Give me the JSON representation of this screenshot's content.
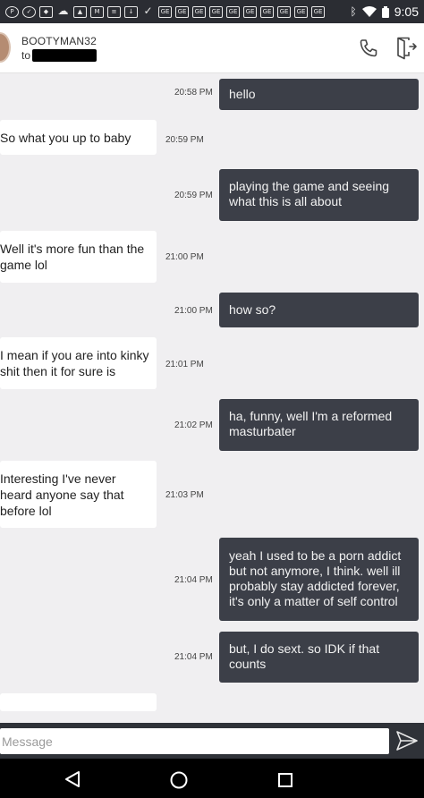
{
  "status_bar": {
    "time": "9:05",
    "icons": [
      "pinterest-icon",
      "check-icon",
      "shield-icon",
      "cloud-icon",
      "image-icon",
      "gmail-icon",
      "news-icon",
      "download-icon",
      "check-mark-icon",
      "ge-icon",
      "ge-icon",
      "ge-icon",
      "ge-icon",
      "ge-icon",
      "ge-icon",
      "ge-icon",
      "ge-icon",
      "ge-icon",
      "ge-icon",
      "bluetooth-icon",
      "wifi-icon",
      "battery-icon"
    ],
    "ge_label": "GE"
  },
  "header": {
    "contact_name": "BOOTYMAN32",
    "to_prefix": "to"
  },
  "messages": [
    {
      "direction": "out",
      "text": "hello",
      "time": "20:58 PM"
    },
    {
      "direction": "in",
      "text": "So what you up to baby",
      "time": "20:59 PM"
    },
    {
      "direction": "out",
      "text": "playing the game and seeing what this is all about",
      "time": "20:59 PM"
    },
    {
      "direction": "in",
      "text": "Well it's more fun than the game lol",
      "time": "21:00 PM"
    },
    {
      "direction": "out",
      "text": "how so?",
      "time": "21:00 PM"
    },
    {
      "direction": "in",
      "text": "I mean if you are into kinky shit then it for sure is",
      "time": "21:01 PM"
    },
    {
      "direction": "out",
      "text": "ha, funny, well I'm a reformed masturbater",
      "time": "21:02 PM"
    },
    {
      "direction": "in",
      "text": "Interesting I've never heard anyone say that before lol",
      "time": "21:03 PM"
    },
    {
      "direction": "out",
      "text": "yeah I used to be a porn addict but not anymore, I think. well ill probably stay addicted forever, it's only a matter of self control",
      "time": "21:04 PM"
    },
    {
      "direction": "out",
      "text": "but, I do sext. so IDK if that counts",
      "time": "21:04 PM"
    }
  ],
  "composer": {
    "placeholder": "Message"
  }
}
